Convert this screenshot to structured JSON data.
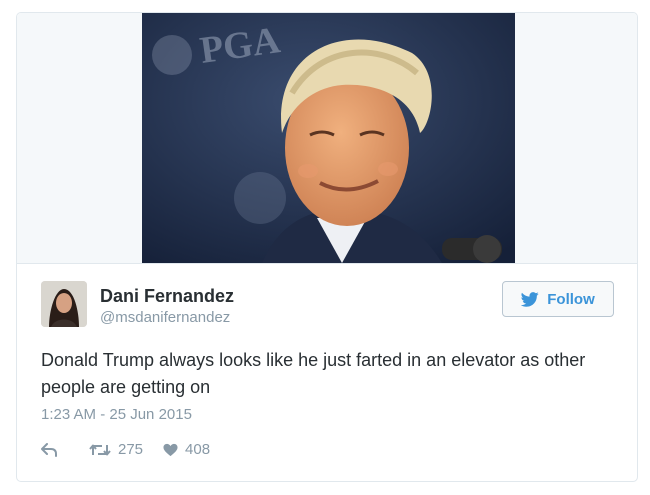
{
  "tweet": {
    "author": {
      "name": "Dani Fernandez",
      "handle": "@msdanifernandez"
    },
    "follow_label": "Follow",
    "text": "Donald Trump always looks like he just farted in an elevator as other people are getting on",
    "timestamp": "1:23 AM - 25 Jun 2015",
    "retweet_count": "275",
    "like_count": "408"
  },
  "media": {
    "backdrop_text": "PGA"
  },
  "icons": {
    "follow": "twitter-bird-icon",
    "reply": "reply-arrow-icon",
    "retweet": "retweet-icon",
    "like": "heart-icon"
  },
  "colors": {
    "accent": "#3b94d9",
    "text": "#292f33",
    "muted": "#8899a6",
    "border": "#e1e8ed"
  }
}
